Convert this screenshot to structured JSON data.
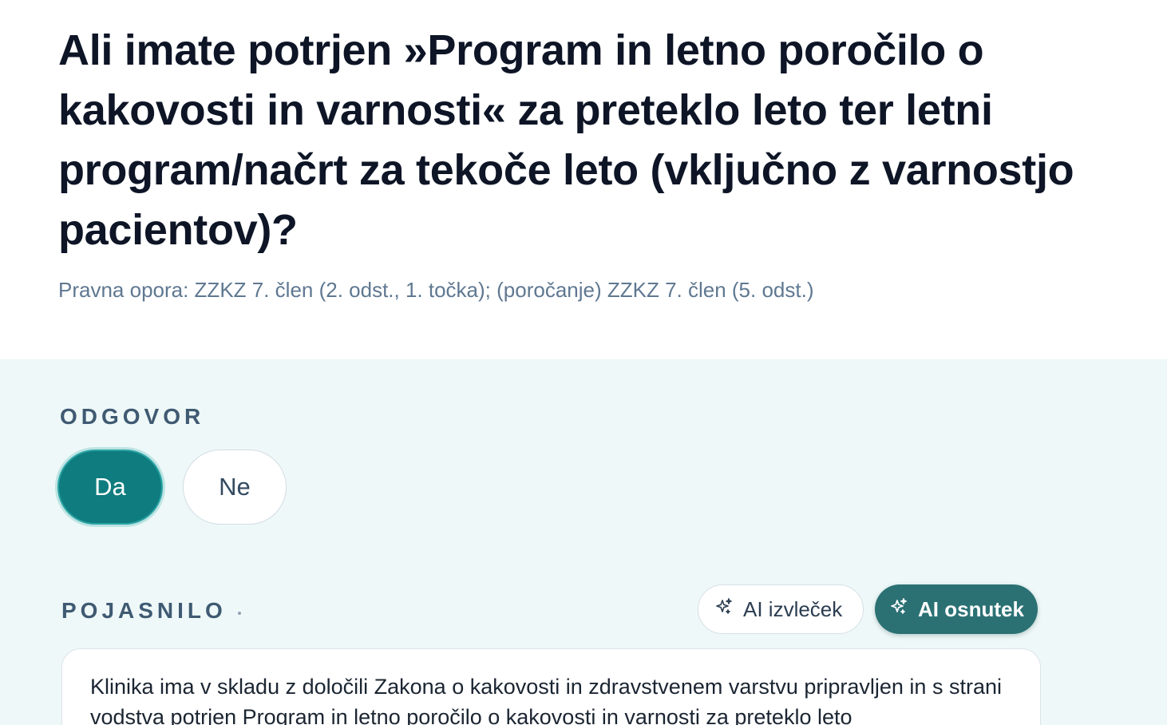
{
  "question": {
    "title": "Ali imate potrjen »Program in letno poročilo o kakovosti in varnosti« za preteklo leto ter letni program/načrt za tekoče leto (vključno z varnostjo pacientov)?",
    "legal_basis": "Pravna opora: ZZKZ 7. člen (2. odst., 1. točka); (poročanje) ZZKZ 7. člen (5. odst.)"
  },
  "answer": {
    "label": "ODGOVOR",
    "options": [
      {
        "label": "Da",
        "selected": true
      },
      {
        "label": "Ne",
        "selected": false
      }
    ]
  },
  "explanation": {
    "label": "POJASNILO",
    "ai_extract_label": "AI izvleček",
    "ai_draft_label": "AI osnutek",
    "text": "Klinika ima v skladu z določili Zakona o kakovosti in zdravstvenem varstvu pripravljen in s strani vodstva potrjen Program in letno poročilo o kakovosti in varnosti za preteklo leto"
  },
  "colors": {
    "accent": "#0f7c7f",
    "ai_draft_bg": "#2b7174",
    "answer_section_bg": "#eef8f8",
    "title": "#0d1526",
    "muted": "#5f7891"
  },
  "icons": {
    "ai_extract": "sparkles-icon",
    "ai_draft": "sparkles-icon"
  }
}
